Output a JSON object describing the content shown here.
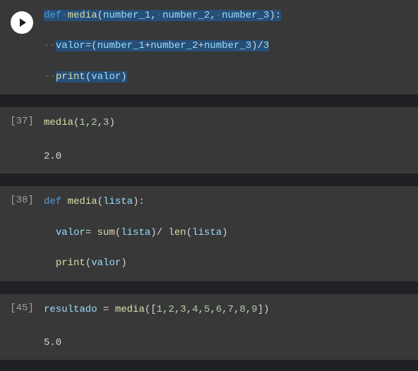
{
  "cells": [
    {
      "execution_label": "",
      "is_active": true,
      "code": {
        "line1": {
          "kw_def": "def",
          "fn_name": "media",
          "paren_open": "(",
          "p1": "number_1",
          "c1": ",",
          "p2": "number_2",
          "c2": ",",
          "p3": "number_3",
          "paren_close": ")",
          "colon": ":"
        },
        "line2": {
          "var": "valor",
          "eq": "=",
          "paren_open": "(",
          "a1": "number_1",
          "plus1": "+",
          "a2": "number_2",
          "plus2": "+",
          "a3": "number_3",
          "paren_close": ")",
          "div": "/",
          "n3": "3"
        },
        "line3": {
          "print": "print",
          "paren_open": "(",
          "arg": "valor",
          "paren_close": ")"
        }
      }
    },
    {
      "execution_label": "[37]",
      "code": {
        "line1": {
          "fn": "media",
          "paren_open": "(",
          "n1": "1",
          "c1": ",",
          "n2": "2",
          "c2": ",",
          "n3": "3",
          "paren_close": ")"
        }
      },
      "output": "2.0"
    },
    {
      "execution_label": "[38]",
      "code": {
        "line1": {
          "kw_def": "def",
          "fn_name": "media",
          "paren_open": "(",
          "p1": "lista",
          "paren_close": ")",
          "colon": ":"
        },
        "line2": {
          "var": "valor",
          "eq": "=",
          "sum": "sum",
          "paren_open1": "(",
          "arg1": "lista",
          "paren_close1": ")",
          "div": "/",
          "len": "len",
          "paren_open2": "(",
          "arg2": "lista",
          "paren_close2": ")"
        },
        "line3": {
          "print": "print",
          "paren_open": "(",
          "arg": "valor",
          "paren_close": ")"
        }
      }
    },
    {
      "execution_label": "[45]",
      "code": {
        "line1": {
          "var": "resultado",
          "eq": "=",
          "fn": "media",
          "paren_open": "(",
          "bracket_open": "[",
          "n1": "1",
          "c1": ",",
          "n2": "2",
          "c2": ",",
          "n3": "3",
          "c3": ",",
          "n4": "4",
          "c4": ",",
          "n5": "5",
          "c5": ",",
          "n6": "6",
          "c6": ",",
          "n7": "7",
          "c7": ",",
          "n8": "8",
          "c8": ",",
          "n9": "9",
          "bracket_close": "]",
          "paren_close": ")"
        }
      },
      "output": "5.0"
    }
  ],
  "ws_dot": "·"
}
